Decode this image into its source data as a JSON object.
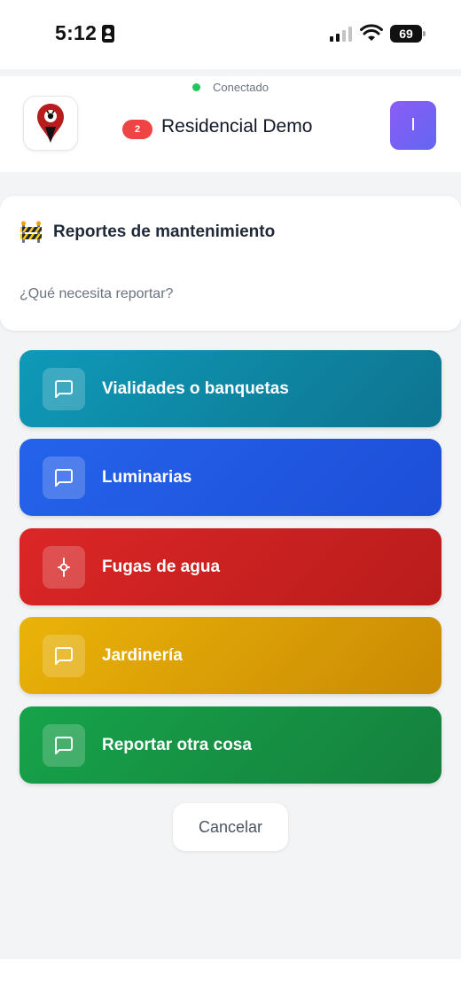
{
  "status_bar": {
    "time": "5:12",
    "battery": "69",
    "signal_bars_active": 2,
    "signal_bars_total": 4
  },
  "header": {
    "connection_status": "Conectado",
    "connection_color": "#22c55e",
    "notification_count": "2",
    "title": "Residencial Demo",
    "avatar_initial": "I",
    "logo_icon": "map-pin-logo-icon"
  },
  "card": {
    "icon": "construction-barrier-icon",
    "title": "Reportes de mantenimiento",
    "prompt": "¿Qué necesita reportar?"
  },
  "options": [
    {
      "label": "Vialidades o banquetas",
      "icon": "message-square-icon",
      "color_from": "#0e9ab8",
      "color_to": "#0e7490"
    },
    {
      "label": "Luminarias",
      "icon": "message-square-icon",
      "color_from": "#2563eb",
      "color_to": "#1d4ed8"
    },
    {
      "label": "Fugas de agua",
      "icon": "water-leak-icon",
      "color_from": "#dc2626",
      "color_to": "#b91c1c"
    },
    {
      "label": "Jardinería",
      "icon": "message-square-icon",
      "color_from": "#eab308",
      "color_to": "#ca8a04"
    },
    {
      "label": "Reportar otra cosa",
      "icon": "message-square-icon",
      "color_from": "#16a34a",
      "color_to": "#15803d"
    }
  ],
  "cancel_label": "Cancelar"
}
